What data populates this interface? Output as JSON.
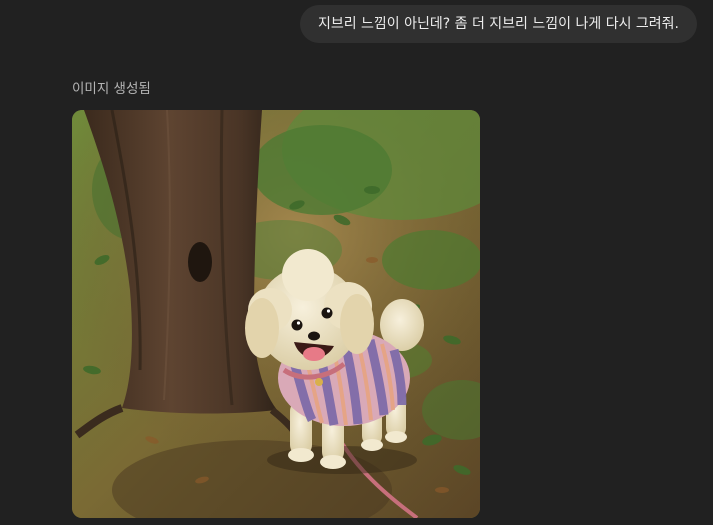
{
  "conversation": {
    "user_message": "지브리 느낌이 아닌데? 좀 더 지브리 느낌이 나게 다시 그려줘.",
    "status_text": "이미지 생성됨",
    "generated_image": {
      "subject": "ghibli-style-dog-in-forest"
    }
  }
}
